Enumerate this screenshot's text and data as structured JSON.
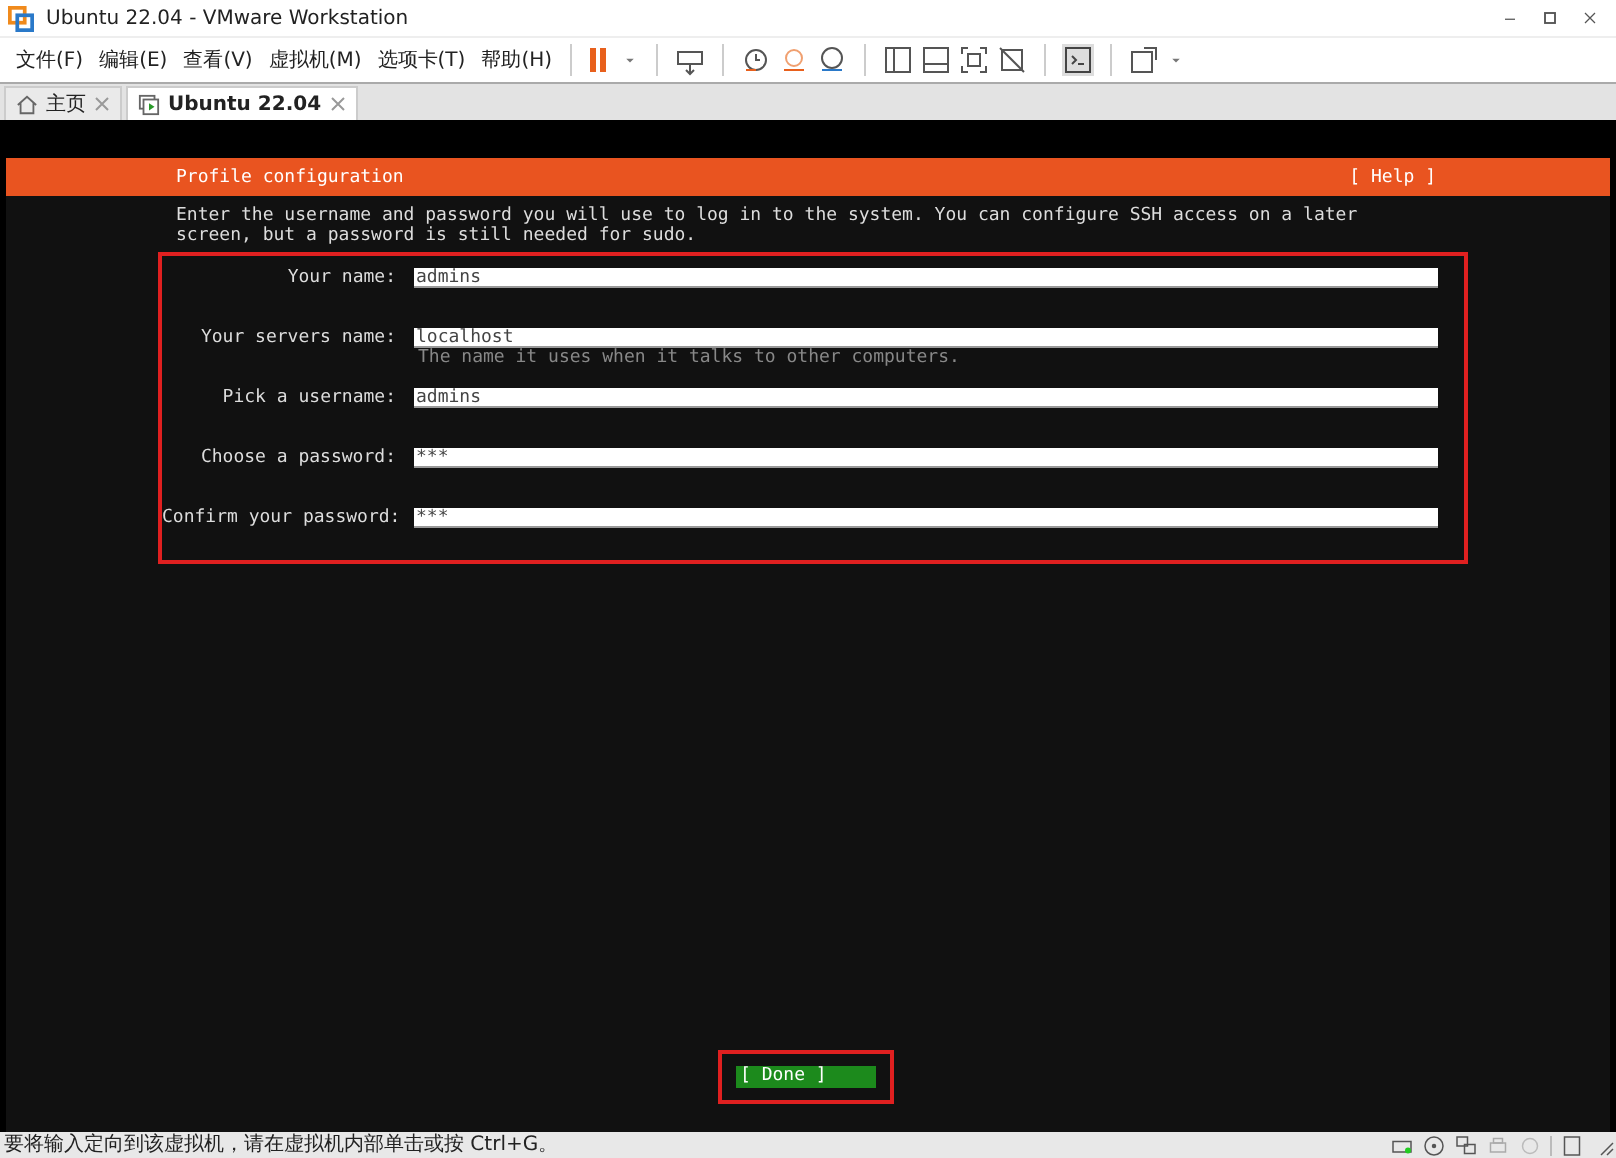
{
  "window": {
    "title": "Ubuntu 22.04 - VMware Workstation"
  },
  "menu": [
    "文件(F)",
    "编辑(E)",
    "查看(V)",
    "虚拟机(M)",
    "选项卡(T)",
    "帮助(H)"
  ],
  "tabs": [
    {
      "label": "主页",
      "kind": "home",
      "selected": false
    },
    {
      "label": "Ubuntu 22.04",
      "kind": "vm",
      "selected": true
    }
  ],
  "installer": {
    "title": "Profile configuration",
    "help": "[ Help ]",
    "description": "Enter the username and password you will use to log in to the system. You can configure SSH access on a later screen, but a password is still needed for sudo.",
    "fields": [
      {
        "label": "Your name:",
        "value": "admins"
      },
      {
        "label": "Your servers name:",
        "value": "localhost",
        "hint": "The name it uses when it talks to other computers."
      },
      {
        "label": "Pick a username:",
        "value": "admins"
      },
      {
        "label": "Choose a password:",
        "value": "***"
      },
      {
        "label": "Confirm your password:",
        "value": "***"
      }
    ],
    "done": "[ Done ]"
  },
  "status_bar": {
    "text": "要将输入定向到该虚拟机，请在虚拟机内部单击或按 Ctrl+G。"
  }
}
